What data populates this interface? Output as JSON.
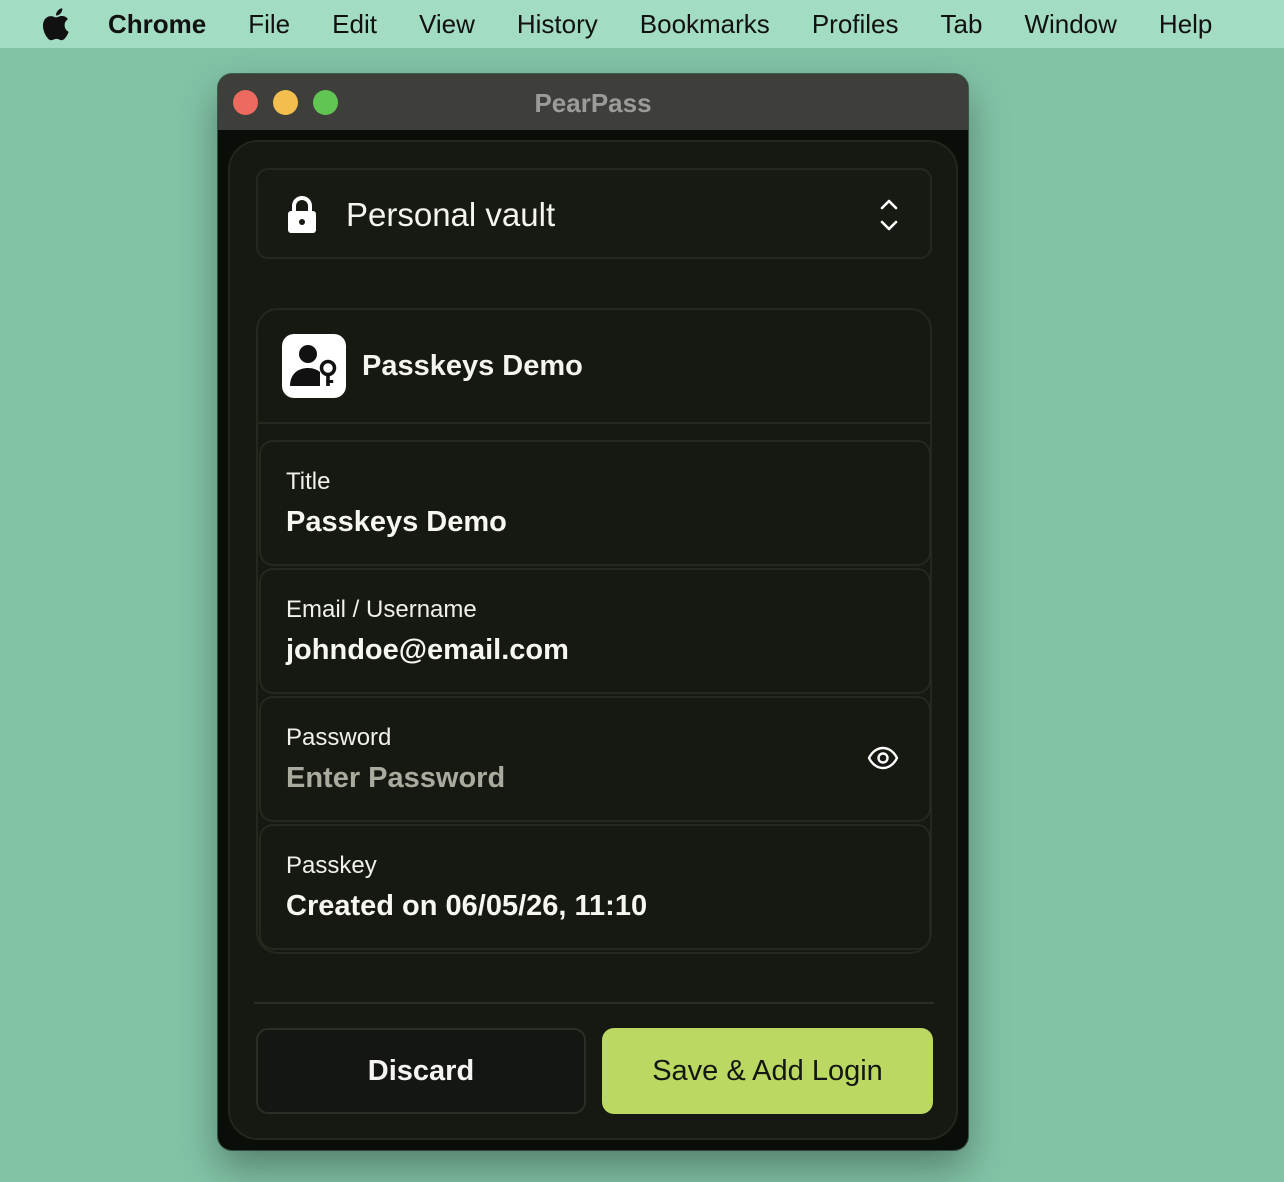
{
  "menubar": {
    "apple_icon": "apple-logo-icon",
    "items": [
      "Chrome",
      "File",
      "Edit",
      "View",
      "History",
      "Bookmarks",
      "Profiles",
      "Tab",
      "Window",
      "Help"
    ]
  },
  "window": {
    "title": "PearPass"
  },
  "vault": {
    "icon": "lock-icon",
    "name": "Personal vault",
    "selector_icon": "chevron-up-down-icon"
  },
  "item": {
    "icon": "user-key-icon",
    "name": "Passkeys Demo",
    "fields": {
      "title": {
        "label": "Title",
        "value": "Passkeys Demo"
      },
      "username": {
        "label": "Email / Username",
        "value": "johndoe@email.com"
      },
      "password": {
        "label": "Password",
        "placeholder": "Enter Password",
        "value": "",
        "toggle_icon": "eye-icon"
      },
      "passkey": {
        "label": "Passkey",
        "value": "Created on 06/05/26, 11:10"
      }
    }
  },
  "actions": {
    "discard": "Discard",
    "save": "Save & Add Login"
  },
  "colors": {
    "background": "#82c3a6",
    "menubar": "#a2dcc2",
    "panel": "#161812",
    "accent": "#bad862"
  }
}
